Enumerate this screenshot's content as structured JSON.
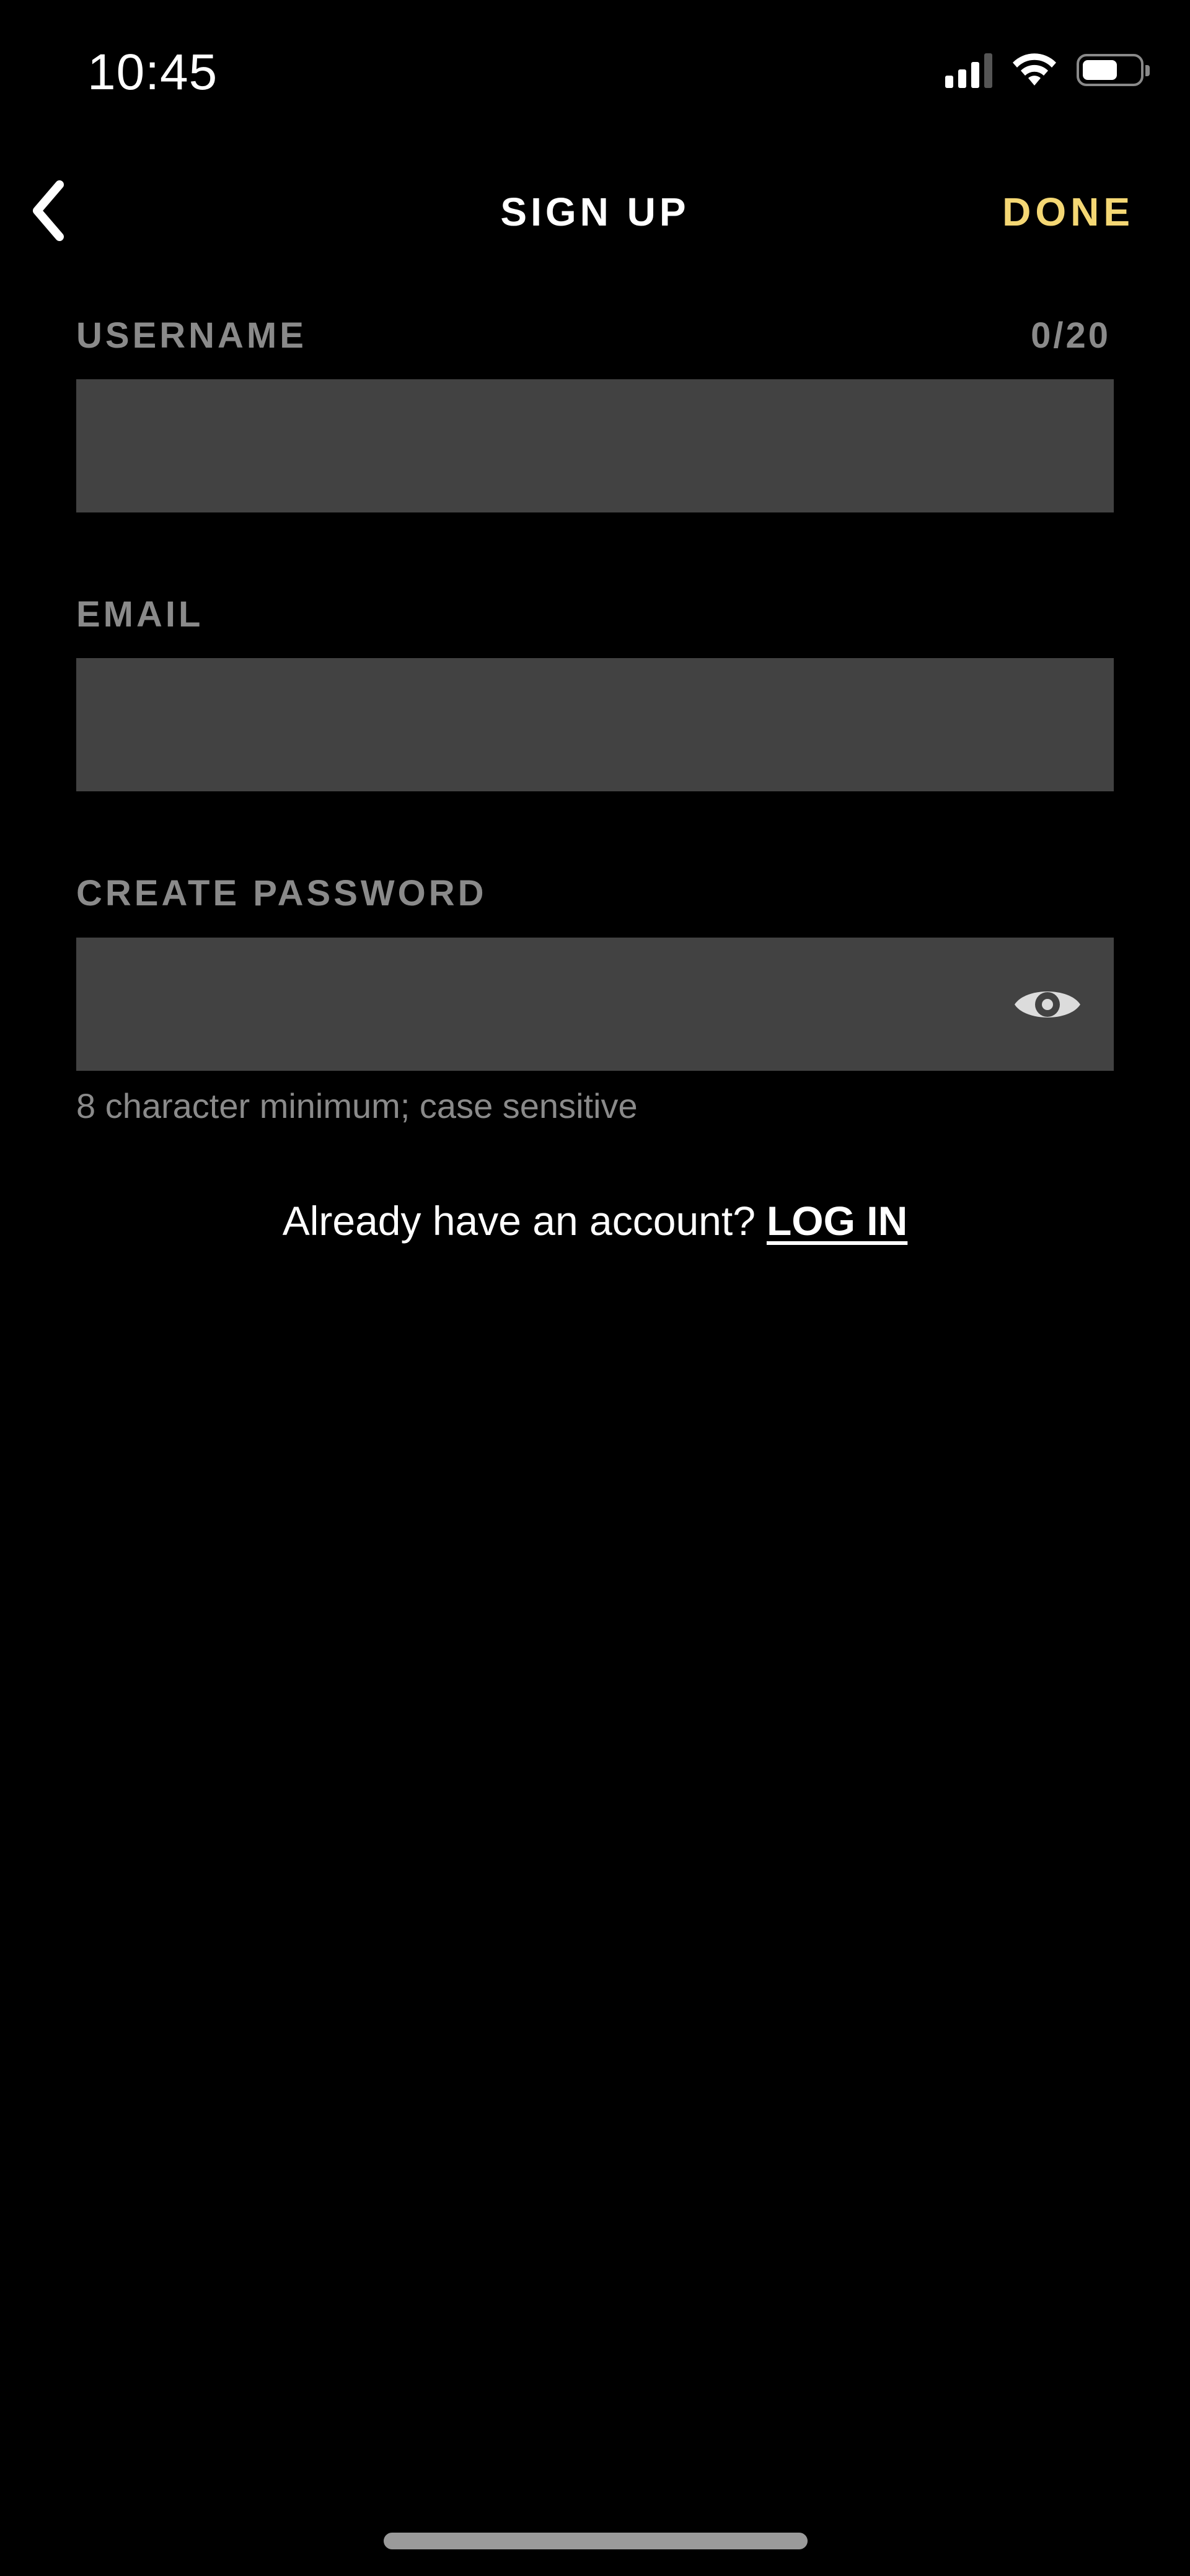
{
  "status_bar": {
    "time": "10:45"
  },
  "nav": {
    "title": "SIGN UP",
    "done_label": "DONE"
  },
  "form": {
    "username": {
      "label": "USERNAME",
      "counter": "0/20",
      "value": ""
    },
    "email": {
      "label": "EMAIL",
      "value": ""
    },
    "password": {
      "label": "CREATE PASSWORD",
      "value": "",
      "hint": "8 character minimum; case sensitive"
    }
  },
  "login_prompt": {
    "text": "Already have an account?",
    "link": "LOG IN"
  },
  "colors": {
    "background": "#000000",
    "field_bg": "#424242",
    "label": "#8a8a8a",
    "accent": "#f4d774",
    "text": "#ffffff"
  },
  "icons": {
    "back": "chevron-left-icon",
    "password_toggle": "eye-icon",
    "signal": "cellular-signal-icon",
    "wifi": "wifi-icon",
    "battery": "battery-icon"
  }
}
